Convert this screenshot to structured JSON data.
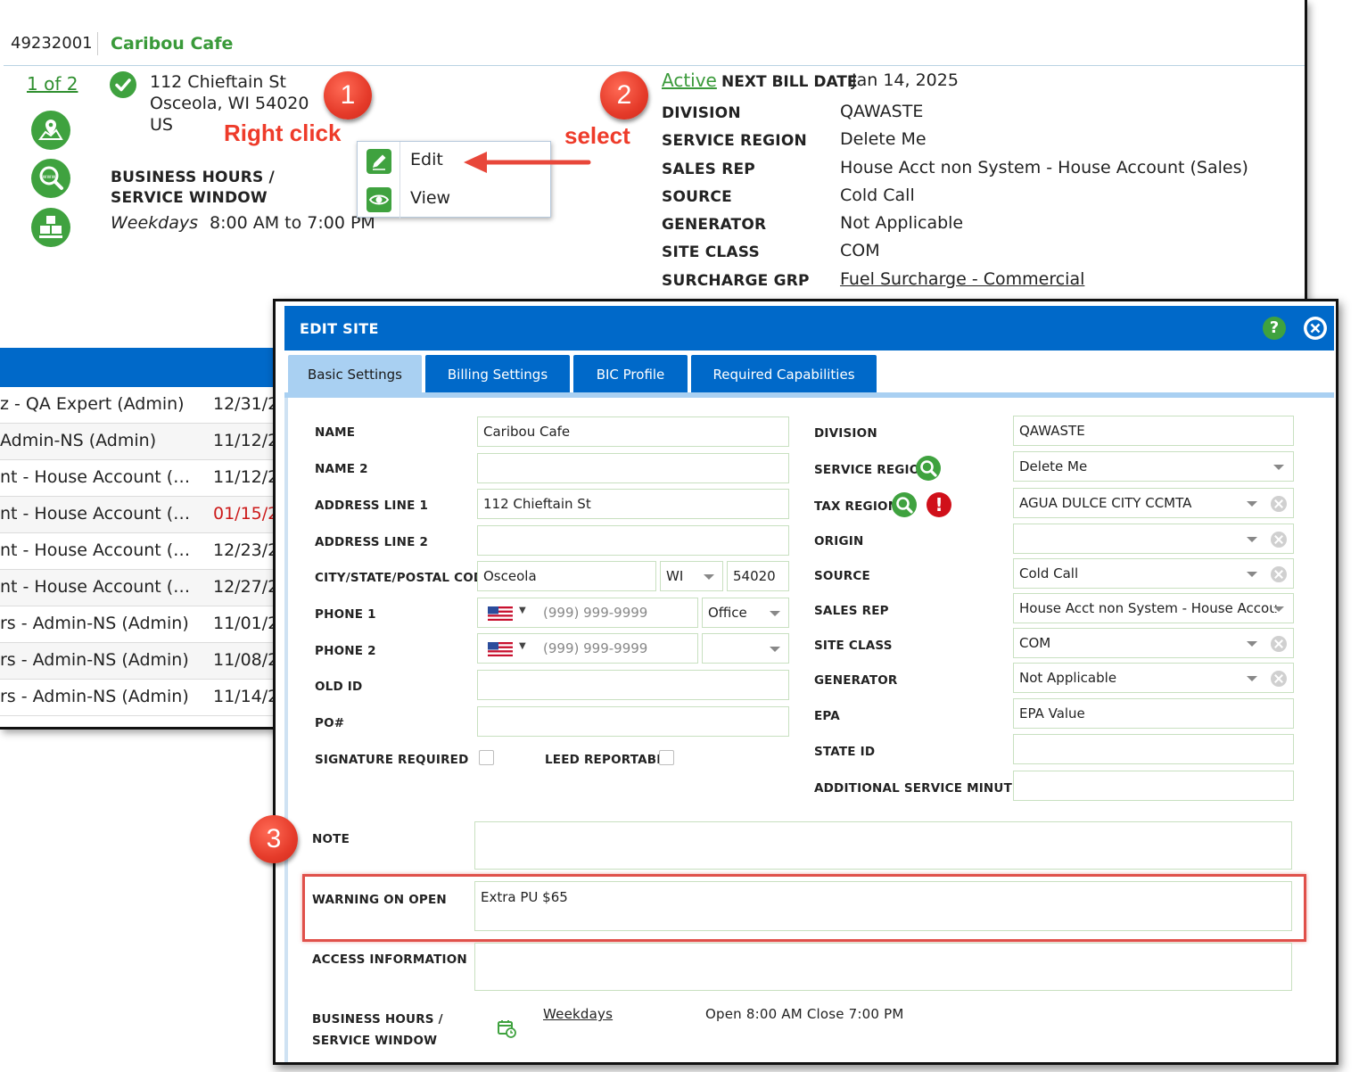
{
  "site": {
    "id": "49232001",
    "name": "Caribou Cafe",
    "pager": "1 of 2",
    "address": "112 Chieftain St\nOsceola, WI 54020\nUS",
    "business_hours_title": "BUSINESS HOURS / SERVICE WINDOW",
    "bh_days": "Weekdays",
    "bh_hours": "8:00 AM to 7:00 PM",
    "status": "Active",
    "next_bill_label": "NEXT BILL DATE",
    "next_bill_value": "Jan 14, 2025",
    "details": [
      {
        "key": "DIVISION",
        "value": "QAWASTE"
      },
      {
        "key": "SERVICE REGION",
        "value": "Delete Me"
      },
      {
        "key": "SALES REP",
        "value": "House Acct non System - House Account (Sales)"
      },
      {
        "key": "SOURCE",
        "value": "Cold Call"
      },
      {
        "key": "GENERATOR",
        "value": "Not Applicable"
      },
      {
        "key": "SITE CLASS",
        "value": "COM"
      },
      {
        "key": "SURCHARGE GRP",
        "value": "Fuel Surcharge - Commercial"
      }
    ]
  },
  "list_rows": [
    {
      "text": "z - QA Expert (Admin)",
      "date": "12/31/2"
    },
    {
      "text": "Admin-NS (Admin)",
      "date": "11/12/2"
    },
    {
      "text": "nt - House Account (…",
      "date": "11/12/2"
    },
    {
      "text": "nt - House Account (…",
      "date": "01/15/2"
    },
    {
      "text": "nt - House Account (…",
      "date": "12/23/2"
    },
    {
      "text": "nt - House Account (…",
      "date": "12/27/2"
    },
    {
      "text": "rs - Admin-NS (Admin)",
      "date": "11/01/2"
    },
    {
      "text": "rs - Admin-NS (Admin)",
      "date": "11/08/2"
    },
    {
      "text": "rs - Admin-NS (Admin)",
      "date": "11/14/2"
    }
  ],
  "context_menu": {
    "edit": "Edit",
    "view": "View"
  },
  "annotations": {
    "step1": "1",
    "step2": "2",
    "step3": "3",
    "right_click": "Right click",
    "select": "select"
  },
  "dialog": {
    "title": "EDIT SITE",
    "help": "?",
    "tabs": [
      "Basic Settings",
      "Billing Settings",
      "BIC Profile",
      "Required Capabilities"
    ],
    "labels": {
      "name": "NAME",
      "name2": "NAME 2",
      "address1": "ADDRESS LINE 1",
      "address2": "ADDRESS LINE 2",
      "city_state_zip": "CITY/STATE/POSTAL CODE",
      "phone1": "PHONE 1",
      "phone2": "PHONE 2",
      "old_id": "OLD ID",
      "po": "PO#",
      "signature": "SIGNATURE REQUIRED",
      "leed": "LEED REPORTABLE",
      "division": "DIVISION",
      "service_region": "SERVICE REGION",
      "tax_region": "TAX REGION",
      "origin": "ORIGIN",
      "source": "SOURCE",
      "sales_rep": "SALES REP",
      "site_class": "SITE CLASS",
      "generator": "GENERATOR",
      "epa": "EPA",
      "state_id": "STATE ID",
      "add_service_minutes": "ADDITIONAL SERVICE MINUTES",
      "note": "NOTE",
      "warning": "WARNING ON OPEN",
      "access": "ACCESS INFORMATION",
      "bh_line1": "BUSINESS HOURS /",
      "bh_line2": "SERVICE WINDOW"
    },
    "values": {
      "name": "Caribou Cafe",
      "address1": "112 Chieftain St",
      "city": "Osceola",
      "state": "WI",
      "zip": "54020",
      "phone_placeholder": "(999) 999-9999",
      "phone1_type": "Office",
      "division": "QAWASTE",
      "service_region": "Delete Me",
      "tax_region": "AGUA DULCE CITY CCMTA",
      "source": "Cold Call",
      "sales_rep": "House Acct non System - House Accou",
      "site_class": "COM",
      "generator": "Not Applicable",
      "epa": "EPA Value",
      "warning": "Extra PU $65",
      "bh_days": "Weekdays",
      "bh_hours": "Open 8:00 AM Close 7:00 PM"
    }
  },
  "colors": {
    "brand_blue": "#0069c9",
    "brand_green": "#3fa23f",
    "annotation_red": "#ee3b2a",
    "warning_red": "#d0101a"
  }
}
